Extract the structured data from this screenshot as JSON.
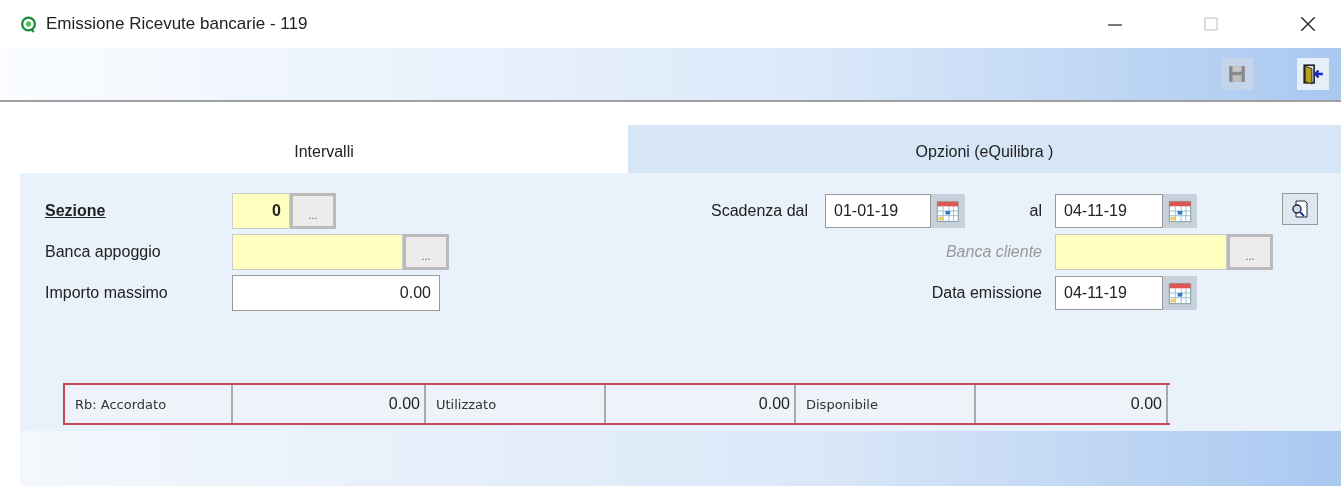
{
  "window": {
    "title": "Emissione Ricevute bancarie - 119"
  },
  "toolbar": [
    {
      "kind": "save",
      "disabled": true
    },
    {
      "kind": "exit",
      "disabled": false
    }
  ],
  "tabs": [
    {
      "label": "Intervalli",
      "selected": true
    },
    {
      "label": "Opzioni (eQuilibra )",
      "selected": false
    }
  ],
  "left_fields": [
    {
      "label": "Sezione",
      "bold": true,
      "kind": "lookup",
      "value": "0",
      "lookup_button": "..."
    },
    {
      "label": "Banca appoggio",
      "bold": false,
      "kind": "lookup",
      "lookup_button": "..."
    },
    {
      "label": "Importo massimo",
      "bold": false,
      "kind": "amount",
      "value": "0.00"
    }
  ],
  "scadenza": {
    "from_label": "Scadenza dal",
    "from": "01-01-19",
    "to_label": "al",
    "to": "04-11-19"
  },
  "banca_cliente": {
    "label": "Banca cliente",
    "disabled": true,
    "lookup_button": "..."
  },
  "data_emissione": {
    "label": "Data emissione",
    "value": "04-11-19"
  },
  "summary": [
    {
      "label": "Rb:  Accordato",
      "value": "0.00"
    },
    {
      "label": "Utilizzato",
      "value": "0.00"
    },
    {
      "label": "Disponibile",
      "value": "0.00"
    }
  ]
}
